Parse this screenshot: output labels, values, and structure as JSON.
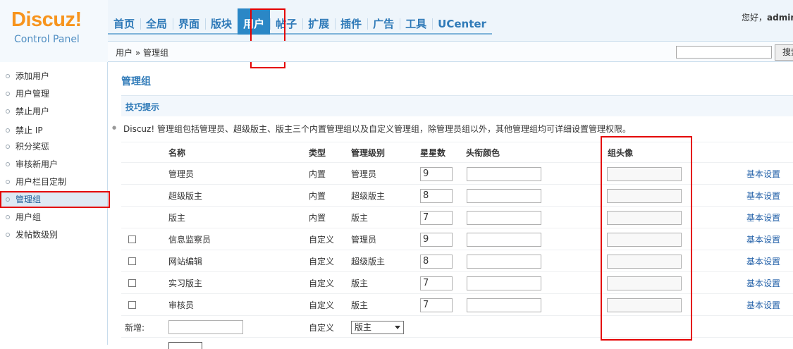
{
  "header": {
    "logo_title": "Discuz!",
    "logo_subtitle": "Control Panel",
    "nav": [
      "首页",
      "全局",
      "界面",
      "版块",
      "用户",
      "帖子",
      "扩展",
      "插件",
      "广告",
      "工具",
      "UCenter"
    ],
    "active_nav": "用户",
    "greeting_prefix": "您好，",
    "greeting_user": "admin"
  },
  "breadcrumb": "用户 » 管理组",
  "search": {
    "value": "",
    "button_label": "搜索"
  },
  "sidebar": {
    "items": [
      "添加用户",
      "用户管理",
      "禁止用户",
      "禁止 IP",
      "积分奖惩",
      "审核新用户",
      "用户栏目定制",
      "管理组",
      "用户组",
      "发帖数级别"
    ],
    "active": "管理组"
  },
  "main": {
    "title": "管理组",
    "tips_title": "技巧提示",
    "tip": "Discuz! 管理组包括管理员、超级版主、版主三个内置管理组以及自定义管理组，除管理员组以外，其他管理组均可详细设置管理权限。",
    "columns": [
      "名称",
      "类型",
      "管理级别",
      "星星数",
      "头衔颜色",
      "组头像"
    ],
    "rows": [
      {
        "name": "管理员",
        "type": "内置",
        "level": "管理员",
        "stars": "9",
        "action": "基本设置",
        "checkbox": false
      },
      {
        "name": "超级版主",
        "type": "内置",
        "level": "超级版主",
        "stars": "8",
        "action": "基本设置",
        "checkbox": false
      },
      {
        "name": "版主",
        "type": "内置",
        "level": "版主",
        "stars": "7",
        "action": "基本设置",
        "checkbox": false
      },
      {
        "name": "信息监察员",
        "type": "自定义",
        "level": "管理员",
        "stars": "9",
        "action": "基本设置",
        "checkbox": true
      },
      {
        "name": "网站编辑",
        "type": "自定义",
        "level": "超级版主",
        "stars": "8",
        "action": "基本设置",
        "checkbox": true
      },
      {
        "name": "实习版主",
        "type": "自定义",
        "level": "版主",
        "stars": "7",
        "action": "基本设置",
        "checkbox": true
      },
      {
        "name": "审核员",
        "type": "自定义",
        "level": "版主",
        "stars": "7",
        "action": "基本设置",
        "checkbox": true
      }
    ],
    "new_row": {
      "label": "新增:",
      "type": "自定义",
      "level_selected": "版主"
    }
  }
}
